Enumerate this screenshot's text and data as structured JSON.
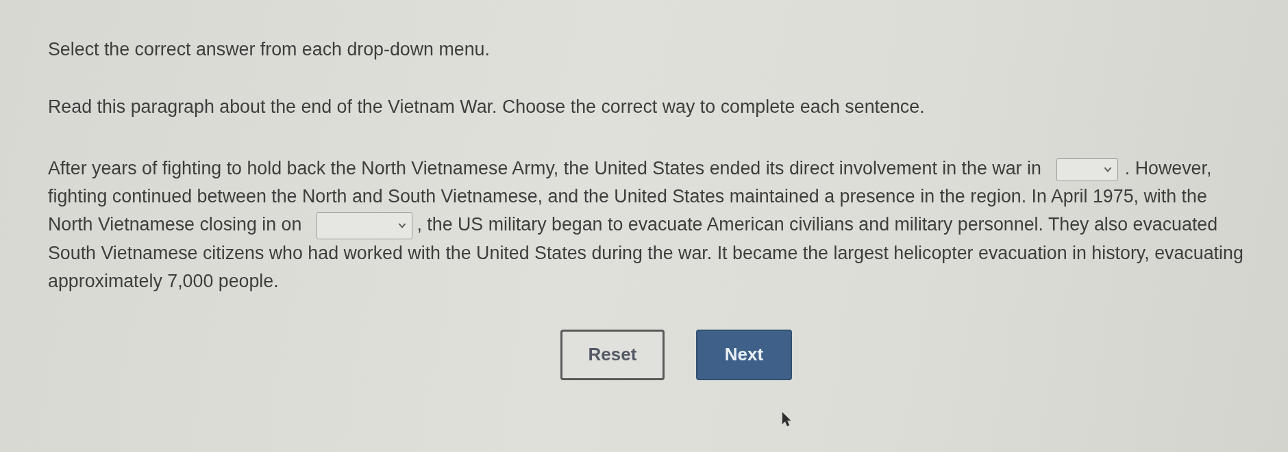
{
  "instructions": [
    "Select the correct answer from each drop-down menu.",
    "Read this paragraph about the end of the Vietnam War. Choose the correct way to complete each sentence."
  ],
  "passage": [
    {
      "kind": "text",
      "text": "After years of fighting to hold back the North Vietnamese Army, the United States ended its direct involvement in the war in"
    },
    {
      "kind": "dropdown"
    },
    {
      "kind": "text",
      "text": ". However, fighting continued between the North and South Vietnamese, and the United States maintained a presence in the region. In April 1975, with the North Vietnamese closing in on"
    },
    {
      "kind": "dropdown"
    },
    {
      "kind": "text",
      "text": ", the US military began to evacuate American civilians and military personnel. They also evacuated South Vietnamese citizens who had worked with the United States during the war. It became the largest helicopter evacuation in history, evacuating approximately 7,000 people."
    }
  ],
  "buttons": [
    {
      "label": "Reset",
      "kind": "secondary"
    },
    {
      "label": "Next",
      "kind": "primary"
    }
  ]
}
